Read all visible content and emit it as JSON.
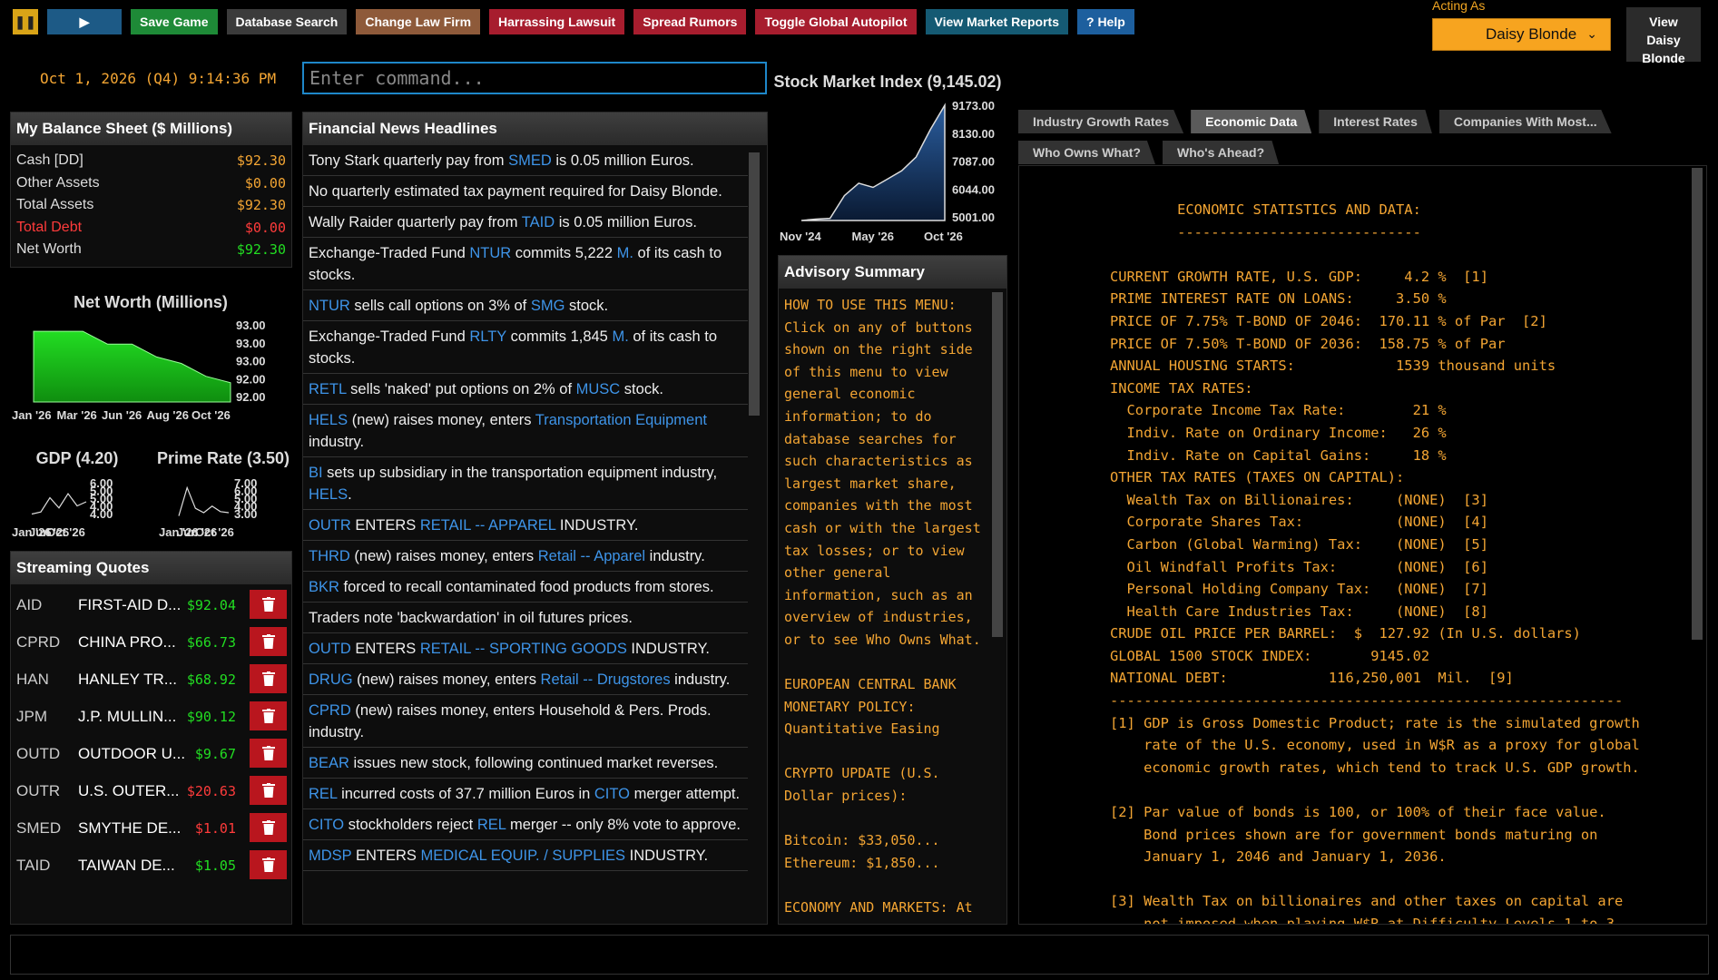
{
  "toolbar": {
    "pause_icon": "pause-icon",
    "play_icon": "play-icon",
    "save": "Save Game",
    "database": "Database Search",
    "law_firm": "Change Law Firm",
    "lawsuit": "Harrassing Lawsuit",
    "rumors": "Spread Rumors",
    "autopilot": "Toggle Global Autopilot",
    "market": "View Market Reports",
    "help": "? Help"
  },
  "acting": {
    "label": "Acting As",
    "value": "Daisy Blonde",
    "view_button": "View Daisy Blonde"
  },
  "datetime": "Oct 1, 2026 (Q4) 9:14:36 PM",
  "command": {
    "placeholder": "Enter command..."
  },
  "balance": {
    "title": "My Balance Sheet ($ Millions)",
    "rows": [
      {
        "label": "Cash [DD]",
        "value": "$92.30",
        "color": "#dddddd"
      },
      {
        "label": "Other Assets",
        "value": "$0.00",
        "color": "#dddddd"
      },
      {
        "label": "Total Assets",
        "value": "$92.30",
        "color": "#dddddd"
      },
      {
        "label": "Total Debt",
        "value": "$0.00",
        "color": "#ff3b3b"
      },
      {
        "label": "Net Worth",
        "value": "$92.30",
        "color": "#dddddd"
      }
    ]
  },
  "net_worth_chart": {
    "title": "Net Worth (Millions)",
    "x_labels": [
      "Jan '26",
      "Mar '26",
      "Jun '26",
      "Aug '26",
      "Oct '26"
    ],
    "y_labels": [
      "93.00",
      "93.00",
      "93.00",
      "92.00",
      "92.00"
    ],
    "values": [
      93.1,
      93.1,
      93.1,
      92.9,
      92.9,
      92.7,
      92.6,
      92.4,
      92.3
    ],
    "color": "#1ec81e"
  },
  "gdp_chart": {
    "title": "GDP (4.20)",
    "x_labels": [
      "Jan '26",
      "Jun '26",
      "Oct '26"
    ],
    "y_labels": [
      "6.00",
      "5.00",
      "5.00",
      "4.00",
      "4.00"
    ],
    "values": [
      3.6,
      3.7,
      4.4,
      3.9,
      4.6,
      4.0,
      4.2
    ]
  },
  "prime_chart": {
    "title": "Prime Rate (3.50)",
    "x_labels": [
      "Jan '26",
      "Jun '26",
      "Oct '26"
    ],
    "y_labels": [
      "7.00",
      "6.00",
      "5.00",
      "4.00",
      "3.00"
    ],
    "values": [
      3.2,
      5.8,
      3.9,
      3.5,
      4.1,
      3.6,
      3.5
    ]
  },
  "quotes": {
    "title": "Streaming Quotes",
    "delete_icon": "trash-icon",
    "rows": [
      {
        "sym": "AID",
        "name": "FIRST-AID D...",
        "price": "$92.04",
        "color": "#22dd22"
      },
      {
        "sym": "CPRD",
        "name": "CHINA PRO...",
        "price": "$66.73",
        "color": "#22dd22"
      },
      {
        "sym": "HAN",
        "name": "HANLEY TR...",
        "price": "$68.92",
        "color": "#22dd22"
      },
      {
        "sym": "JPM",
        "name": "J.P. MULLIN...",
        "price": "$90.12",
        "color": "#22dd22"
      },
      {
        "sym": "OUTD",
        "name": "OUTDOOR U...",
        "price": "$9.67",
        "color": "#22dd22"
      },
      {
        "sym": "OUTR",
        "name": "U.S. OUTER...",
        "price": "$20.63",
        "color": "#ff3b3b"
      },
      {
        "sym": "SMED",
        "name": "SMYTHE DE...",
        "price": "$1.01",
        "color": "#ff3b3b"
      },
      {
        "sym": "TAID",
        "name": "TAIWAN DE...",
        "price": "$1.05",
        "color": "#22dd22"
      }
    ]
  },
  "news": {
    "title": "Financial News Headlines",
    "items": [
      [
        {
          "t": "Tony Stark quarterly pay from "
        },
        {
          "t": "SMED",
          "l": true
        },
        {
          "t": " is 0.05 million Euros."
        }
      ],
      [
        {
          "t": "No quarterly estimated tax payment required for Daisy Blonde."
        }
      ],
      [
        {
          "t": "Wally Raider quarterly pay from "
        },
        {
          "t": "TAID",
          "l": true
        },
        {
          "t": " is 0.05 million Euros."
        }
      ],
      [
        {
          "t": "Exchange-Traded Fund "
        },
        {
          "t": "NTUR",
          "l": true
        },
        {
          "t": " commits 5,222 "
        },
        {
          "t": "M.",
          "l": true
        },
        {
          "t": " of its cash to stocks."
        }
      ],
      [
        {
          "t": "NTUR",
          "l": true
        },
        {
          "t": " sells call options on 3% of "
        },
        {
          "t": "SMG",
          "l": true
        },
        {
          "t": " stock."
        }
      ],
      [
        {
          "t": "Exchange-Traded Fund "
        },
        {
          "t": "RLTY",
          "l": true
        },
        {
          "t": " commits 1,845 "
        },
        {
          "t": "M.",
          "l": true
        },
        {
          "t": " of its cash to stocks."
        }
      ],
      [
        {
          "t": "RETL",
          "l": true
        },
        {
          "t": " sells 'naked' put options on 2% of "
        },
        {
          "t": "MUSC",
          "l": true
        },
        {
          "t": " stock."
        }
      ],
      [
        {
          "t": "HELS",
          "l": true
        },
        {
          "t": " (new) raises money, enters "
        },
        {
          "t": "Transportation Equipment",
          "l": true
        },
        {
          "t": " industry."
        }
      ],
      [
        {
          "t": "BI",
          "l": true
        },
        {
          "t": " sets up subsidiary in the transportation equipment industry, "
        },
        {
          "t": "HELS",
          "l": true
        },
        {
          "t": "."
        }
      ],
      [
        {
          "t": "OUTR",
          "l": true
        },
        {
          "t": " ENTERS "
        },
        {
          "t": "RETAIL -- APPAREL",
          "l": true
        },
        {
          "t": " INDUSTRY."
        }
      ],
      [
        {
          "t": "THRD",
          "l": true
        },
        {
          "t": " (new) raises money, enters "
        },
        {
          "t": "Retail -- Apparel",
          "l": true
        },
        {
          "t": " industry."
        }
      ],
      [
        {
          "t": "BKR",
          "l": true
        },
        {
          "t": " forced to recall contaminated food products from stores."
        }
      ],
      [
        {
          "t": "Traders note 'backwardation' in oil futures prices."
        }
      ],
      [
        {
          "t": "OUTD",
          "l": true
        },
        {
          "t": " ENTERS "
        },
        {
          "t": "RETAIL -- SPORTING GOODS",
          "l": true
        },
        {
          "t": " INDUSTRY."
        }
      ],
      [
        {
          "t": "DRUG",
          "l": true
        },
        {
          "t": " (new) raises money, enters "
        },
        {
          "t": "Retail -- Drugstores",
          "l": true
        },
        {
          "t": " industry."
        }
      ],
      [
        {
          "t": "CPRD",
          "l": true
        },
        {
          "t": " (new) raises money, enters Household & Pers. Prods. industry."
        }
      ],
      [
        {
          "t": "BEAR",
          "l": true
        },
        {
          "t": " issues new stock, following continued market reverses."
        }
      ],
      [
        {
          "t": "REL",
          "l": true
        },
        {
          "t": " incurred costs of 37.7 million Euros in "
        },
        {
          "t": "CITO",
          "l": true
        },
        {
          "t": " merger attempt."
        }
      ],
      [
        {
          "t": "CITO",
          "l": true
        },
        {
          "t": " stockholders reject "
        },
        {
          "t": "REL",
          "l": true
        },
        {
          "t": " merger -- only 8% vote to approve."
        }
      ],
      [
        {
          "t": "MDSP",
          "l": true
        },
        {
          "t": " ENTERS "
        },
        {
          "t": "MEDICAL EQUIP. / SUPPLIES",
          "l": true
        },
        {
          "t": " INDUSTRY."
        }
      ]
    ]
  },
  "market_chart": {
    "title": "Stock Market Index (9,145.02)",
    "x_labels": [
      "Nov '24",
      "May '26",
      "Oct '26"
    ],
    "y_labels": [
      "9173.00",
      "8130.00",
      "7087.00",
      "6044.00",
      "5001.00"
    ],
    "values": [
      5001,
      5050,
      5080,
      5900,
      6350,
      6200,
      6500,
      6800,
      7300,
      8300,
      9173
    ],
    "color": "#2a5d9e"
  },
  "advisory": {
    "title": "Advisory Summary",
    "text": "HOW TO USE THIS MENU:\nClick on any of buttons shown on the right side of this menu to view general economic information; to do database searches for such characteristics as largest market share, companies with the most cash or with the largest tax losses; or to view other general information, such as an overview of industries, or to see Who Owns What.\n\nEUROPEAN CENTRAL BANK MONETARY POLICY: Quantitative Easing\n\nCRYPTO UPDATE (U.S. Dollar prices):\n\nBitcoin: $33,050...\nEthereum: $1,850...\n\nECONOMY AND MARKETS: At"
  },
  "tabs_row1": [
    {
      "label": "Industry Growth Rates",
      "active": false
    },
    {
      "label": "Economic Data",
      "active": true
    },
    {
      "label": "Interest Rates",
      "active": false
    },
    {
      "label": "Companies With Most...",
      "active": false
    }
  ],
  "tabs_row2": [
    {
      "label": "Who Owns What?",
      "active": false
    },
    {
      "label": "Who's Ahead?",
      "active": false
    }
  ],
  "econ": {
    "text": "        ECONOMIC STATISTICS AND DATA:\n        -----------------------------\n\nCURRENT GROWTH RATE, U.S. GDP:     4.2 %  [1]\nPRIME INTEREST RATE ON LOANS:     3.50 %\nPRICE OF 7.75% T-BOND OF 2046:  170.11 % of Par  [2]\nPRICE OF 7.50% T-BOND OF 2036:  158.75 % of Par\nANNUAL HOUSING STARTS:            1539 thousand units\nINCOME TAX RATES:\n  Corporate Income Tax Rate:        21 %\n  Indiv. Rate on Ordinary Income:   26 %\n  Indiv. Rate on Capital Gains:     18 %\nOTHER TAX RATES (TAXES ON CAPITAL):\n  Wealth Tax on Billionaires:     (NONE)  [3]\n  Corporate Shares Tax:           (NONE)  [4]\n  Carbon (Global Warming) Tax:    (NONE)  [5]\n  Oil Windfall Profits Tax:       (NONE)  [6]\n  Personal Holding Company Tax:   (NONE)  [7]\n  Health Care Industries Tax:     (NONE)  [8]\nCRUDE OIL PRICE PER BARREL:  $  127.92 (In U.S. dollars)\nGLOBAL 1500 STOCK INDEX:       9145.02\nNATIONAL DEBT:            116,250,001  Mil.  [9]\n-------------------------------------------------------------\n[1] GDP is Gross Domestic Product; rate is the simulated growth\n    rate of the U.S. economy, used in W$R as a proxy for global\n    economic growth rates, which tend to track U.S. GDP growth.\n\n[2] Par value of bonds is 100, or 100% of their face value.\n    Bond prices shown are for government bonds maturing on\n    January 1, 2046 and January 1, 2036.\n\n[3] Wealth Tax on billionaires and other taxes on capital are\n    not imposed when playing W$R at Difficulty Levels 1 to 3."
  }
}
